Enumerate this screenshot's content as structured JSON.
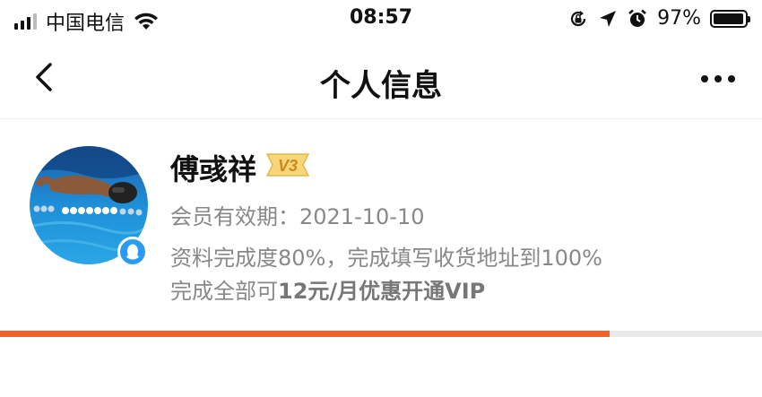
{
  "status_bar": {
    "carrier": "中国电信",
    "time": "08:57",
    "battery_pct": "97%",
    "battery_level": 0.97,
    "icons": [
      "signal-icon",
      "wifi-icon",
      "rotation-lock-icon",
      "location-icon",
      "alarm-icon",
      "battery-icon"
    ]
  },
  "nav": {
    "title": "个人信息",
    "back_icon": "chevron-left-icon",
    "more_icon": "more-dots-icon"
  },
  "profile": {
    "name": "傅彧祥",
    "vip_level": "V3",
    "expiry_label": "会员有效期：",
    "expiry_date": "2021-10-10",
    "completion_text": "资料完成度80%，完成填写收货地址到100%",
    "offer_prefix": "完成全部可",
    "offer_bold": "12元/月优惠开通VIP",
    "avatar_icon": "avatar-swimmer",
    "badge_icon": "qq-penguin-icon"
  },
  "progress": {
    "fraction": 0.8,
    "color": "#f0622d"
  }
}
